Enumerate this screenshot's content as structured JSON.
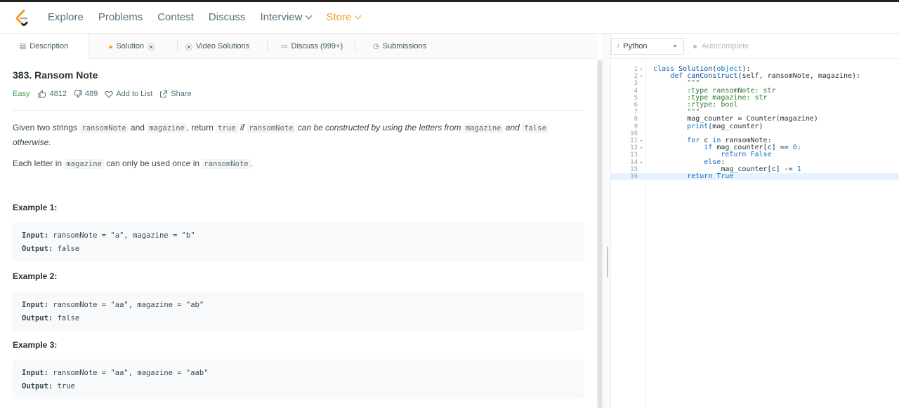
{
  "nav": {
    "items": [
      "Explore",
      "Problems",
      "Contest",
      "Discuss",
      "Interview",
      "Store"
    ]
  },
  "tabs": {
    "description": "Description",
    "solution": "Solution",
    "video": "Video Solutions",
    "discuss": "Discuss (999+)",
    "submissions": "Submissions"
  },
  "problem": {
    "title": "383. Ransom Note",
    "difficulty": "Easy",
    "likes": "4812",
    "dislikes": "489",
    "add_to_list": "Add to List",
    "share": "Share",
    "para1": {
      "t1": "Given two strings ",
      "c1": "ransomNote",
      "t2": " and ",
      "c2": "magazine",
      "t3": ", return ",
      "c3": "true",
      "i1": " if ",
      "c4": "ransomNote",
      "i2": " can be constructed by using the letters from ",
      "c5": "magazine",
      "i3": " and ",
      "c6": "false",
      "i4": "otherwise."
    },
    "para2": {
      "t1": "Each letter in ",
      "c1": "magazine",
      "t2": " can only be used once in ",
      "c2": "ransomNote",
      "t3": "."
    },
    "examples": [
      {
        "heading": "Example 1:",
        "input_label": "Input:",
        "input": " ransomNote = \"a\", magazine = \"b\"",
        "output_label": "Output:",
        "output": " false"
      },
      {
        "heading": "Example 2:",
        "input_label": "Input:",
        "input": " ransomNote = \"aa\", magazine = \"ab\"",
        "output_label": "Output:",
        "output": " false"
      },
      {
        "heading": "Example 3:",
        "input_label": "Input:",
        "input": " ransomNote = \"aa\", magazine = \"aab\"",
        "output_label": "Output:",
        "output": " true"
      }
    ]
  },
  "editor": {
    "language": "Python",
    "language_prefix": "i",
    "autocomplete": "Autocomplete",
    "lines": [
      {
        "n": "1",
        "fold": "▾",
        "code": "class Solution(object):"
      },
      {
        "n": "2",
        "fold": "▾",
        "code": "    def canConstruct(self, ransomNote, magazine):"
      },
      {
        "n": "3",
        "fold": "",
        "code": "        \"\"\""
      },
      {
        "n": "4",
        "fold": "",
        "code": "        :type ransomNote: str"
      },
      {
        "n": "5",
        "fold": "",
        "code": "        :type magazine: str"
      },
      {
        "n": "6",
        "fold": "",
        "code": "        :rtype: bool"
      },
      {
        "n": "7",
        "fold": "",
        "code": "        \"\"\""
      },
      {
        "n": "8",
        "fold": "",
        "code": "        mag_counter = Counter(magazine)"
      },
      {
        "n": "9",
        "fold": "",
        "code": "        print(mag_counter)"
      },
      {
        "n": "10",
        "fold": "",
        "code": ""
      },
      {
        "n": "11",
        "fold": "▾",
        "code": "        for c in ransomNote:"
      },
      {
        "n": "12",
        "fold": "▾",
        "code": "            if mag_counter[c] == 0:"
      },
      {
        "n": "13",
        "fold": "",
        "code": "                return False"
      },
      {
        "n": "14",
        "fold": "▾",
        "code": "            else:"
      },
      {
        "n": "15",
        "fold": "",
        "code": "                mag_counter[c] -= 1"
      },
      {
        "n": "16",
        "fold": "",
        "code": "        return True"
      }
    ]
  }
}
